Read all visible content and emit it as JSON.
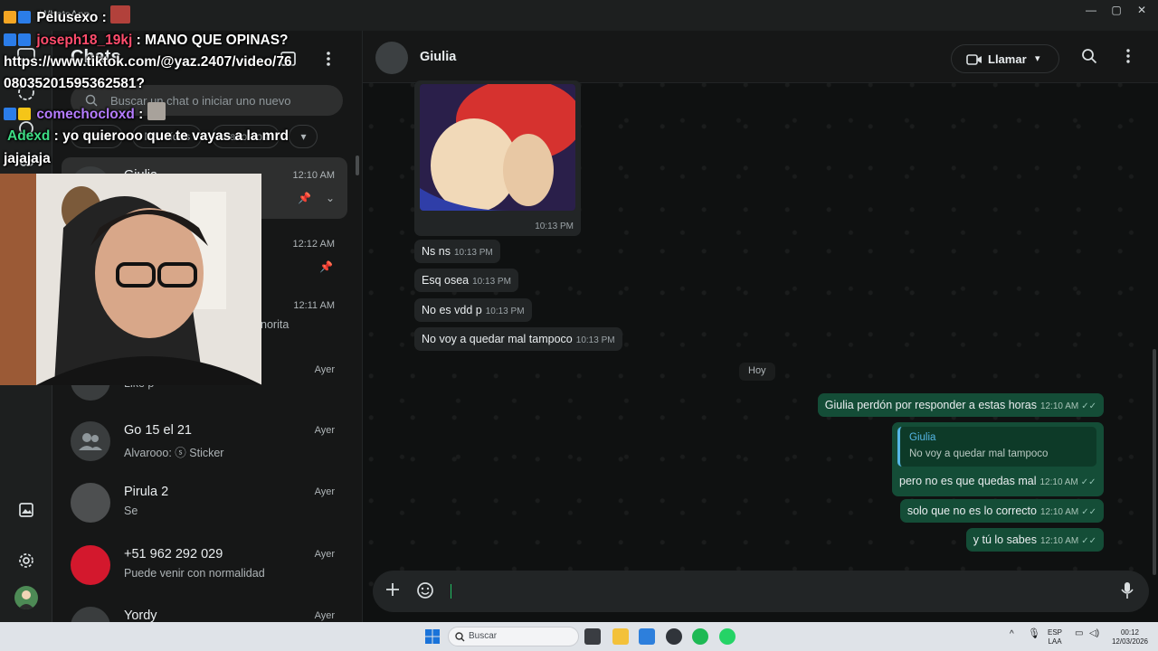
{
  "window": {
    "title": "WhatsApp",
    "minimize_glyph": "—",
    "maximize_glyph": "▢",
    "close_glyph": "✕"
  },
  "chatlist": {
    "title": "Chats",
    "search_placeholder": "Buscar un chat o iniciar uno nuevo",
    "filters": [
      "Todos",
      "No leídos",
      "Favoritos"
    ],
    "items": [
      {
        "name": "Giulia",
        "sub": "",
        "time": "12:10 AM",
        "pinned": true,
        "selected": true
      },
      {
        "name": "",
        "sub": "",
        "time": "12:12 AM",
        "pinned": true,
        "selected": false
      },
      {
        "name": "",
        "sub": "norita",
        "time": "12:11 AM",
        "pinned": false,
        "selected": false
      },
      {
        "name": "",
        "sub": "Like p",
        "time": "Ayer",
        "pinned": false,
        "selected": false
      },
      {
        "name": "Go 15 el 21",
        "sub": "Alvarooo: ⓢ Sticker",
        "time": "Ayer",
        "pinned": false,
        "selected": false
      },
      {
        "name": "Pirula 2",
        "sub": "Se",
        "time": "Ayer",
        "pinned": false,
        "selected": false
      },
      {
        "name": "+51 962 292 029",
        "sub": "Puede venir con normalidad",
        "time": "Ayer",
        "pinned": false,
        "selected": false
      },
      {
        "name": "Yordy",
        "sub": "",
        "time": "Ayer",
        "pinned": false,
        "selected": false
      }
    ]
  },
  "chat": {
    "contact": "Giulia",
    "call_label": "Llamar",
    "image_time": "10:13 PM",
    "incoming": [
      {
        "text": "Ns ns",
        "time": "10:13 PM"
      },
      {
        "text": "Esq osea",
        "time": "10:13 PM"
      },
      {
        "text": "No es vdd p",
        "time": "10:13 PM"
      },
      {
        "text": "No voy a quedar mal tampoco",
        "time": "10:13 PM"
      }
    ],
    "day_label": "Hoy",
    "outgoing": [
      {
        "text": "Giulia perdón por responder a estas horas",
        "time": "12:10 AM"
      },
      {
        "text": "pero no es que quedas mal",
        "time": "12:10 AM",
        "quote_name": "Giulia",
        "quote_text": "No voy a quedar mal tampoco"
      },
      {
        "text": "solo que no es lo correcto",
        "time": "12:10 AM"
      },
      {
        "text": "y tú lo sabes",
        "time": "12:10 AM"
      }
    ],
    "read_tick": "✓✓"
  },
  "taskbar": {
    "search_placeholder": "Buscar",
    "lang": "ESP",
    "lang2": "LAA",
    "time": "00:12",
    "date": "12/03/2026"
  },
  "overlay": {
    "lines": [
      {
        "user": "Pelusexo",
        "msg": "",
        "color": "#ffffff"
      },
      {
        "user": "joseph18_19kj",
        "msg": "MANO QUE OPINAS?",
        "color": "#ff4d6d"
      },
      {
        "user": "",
        "msg": "https://www.tiktok.com/@yaz.2407/video/76",
        "color": "#ffffff"
      },
      {
        "user": "",
        "msg": "08035201595362581?",
        "color": "#ffffff"
      },
      {
        "user": "comechocloxd",
        "msg": "",
        "color": "#b57cff"
      },
      {
        "user": "Adexd",
        "msg": "yo quierooo que te vayas a la mrd",
        "color": "#3ddc84"
      },
      {
        "user": "",
        "msg": "jajajaja",
        "color": "#ffffff"
      }
    ]
  },
  "icons": {
    "rail": [
      "chats-icon",
      "status-icon",
      "channels-icon",
      "communities-icon",
      "media-icon",
      "settings-icon"
    ],
    "header": [
      "video-call-icon",
      "search-icon",
      "more-icon"
    ],
    "composer": [
      "plus-icon",
      "sticker-icon",
      "mic-icon"
    ]
  }
}
